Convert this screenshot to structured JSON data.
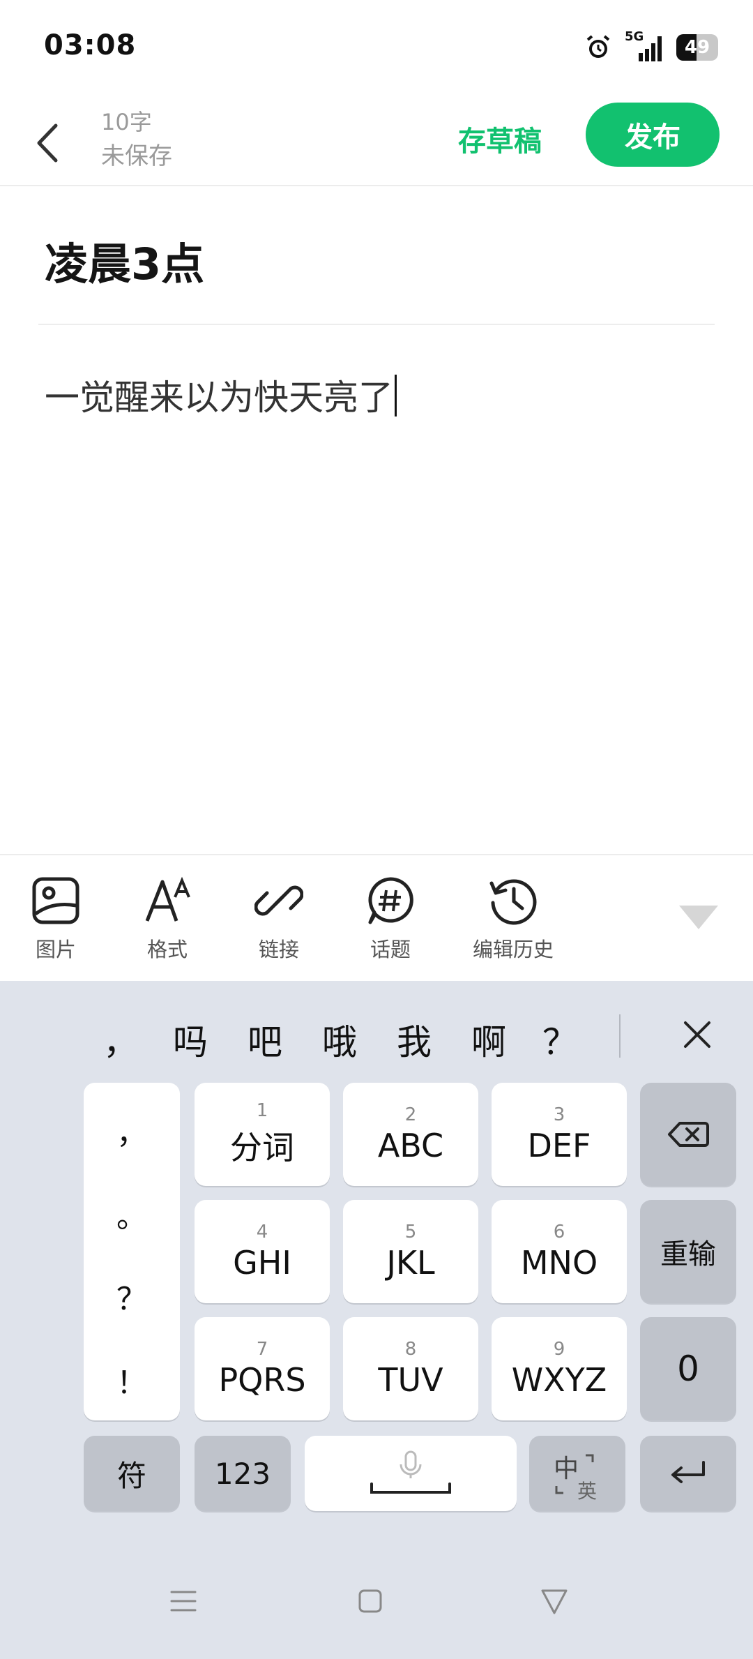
{
  "status_bar": {
    "time": "03:08",
    "network": "5G",
    "battery": "49",
    "battery_level": 0.49
  },
  "header": {
    "word_count": "10字",
    "save_state": "未保存",
    "draft_label": "存草稿",
    "publish_label": "发布"
  },
  "editor": {
    "title": "凌晨3点",
    "body": "一觉醒来以为快天亮了"
  },
  "toolbar": {
    "items": [
      {
        "label": "图片",
        "icon": "image-icon"
      },
      {
        "label": "格式",
        "icon": "format-icon"
      },
      {
        "label": "链接",
        "icon": "link-icon"
      },
      {
        "label": "话题",
        "icon": "topic-icon"
      },
      {
        "label": "编辑历史",
        "icon": "history-icon"
      }
    ]
  },
  "keyboard": {
    "candidates": [
      "，",
      "吗",
      "吧",
      "哦",
      "我",
      "啊",
      "？"
    ],
    "punctuation": [
      "，",
      "。",
      "？",
      "！"
    ],
    "keys": [
      {
        "num": "1",
        "label": "分词"
      },
      {
        "num": "2",
        "label": "ABC"
      },
      {
        "num": "3",
        "label": "DEF"
      },
      {
        "num": "4",
        "label": "GHI"
      },
      {
        "num": "5",
        "label": "JKL"
      },
      {
        "num": "6",
        "label": "MNO"
      },
      {
        "num": "7",
        "label": "PQRS"
      },
      {
        "num": "8",
        "label": "TUV"
      },
      {
        "num": "9",
        "label": "WXYZ"
      }
    ],
    "retype": "重输",
    "zero": "0",
    "symbol": "符",
    "numeric": "123",
    "lang_primary": "中",
    "lang_secondary": "英"
  },
  "colors": {
    "accent": "#12c16f",
    "keyboard_bg": "#dfe3eb",
    "key_gray": "#bfc3cb"
  }
}
